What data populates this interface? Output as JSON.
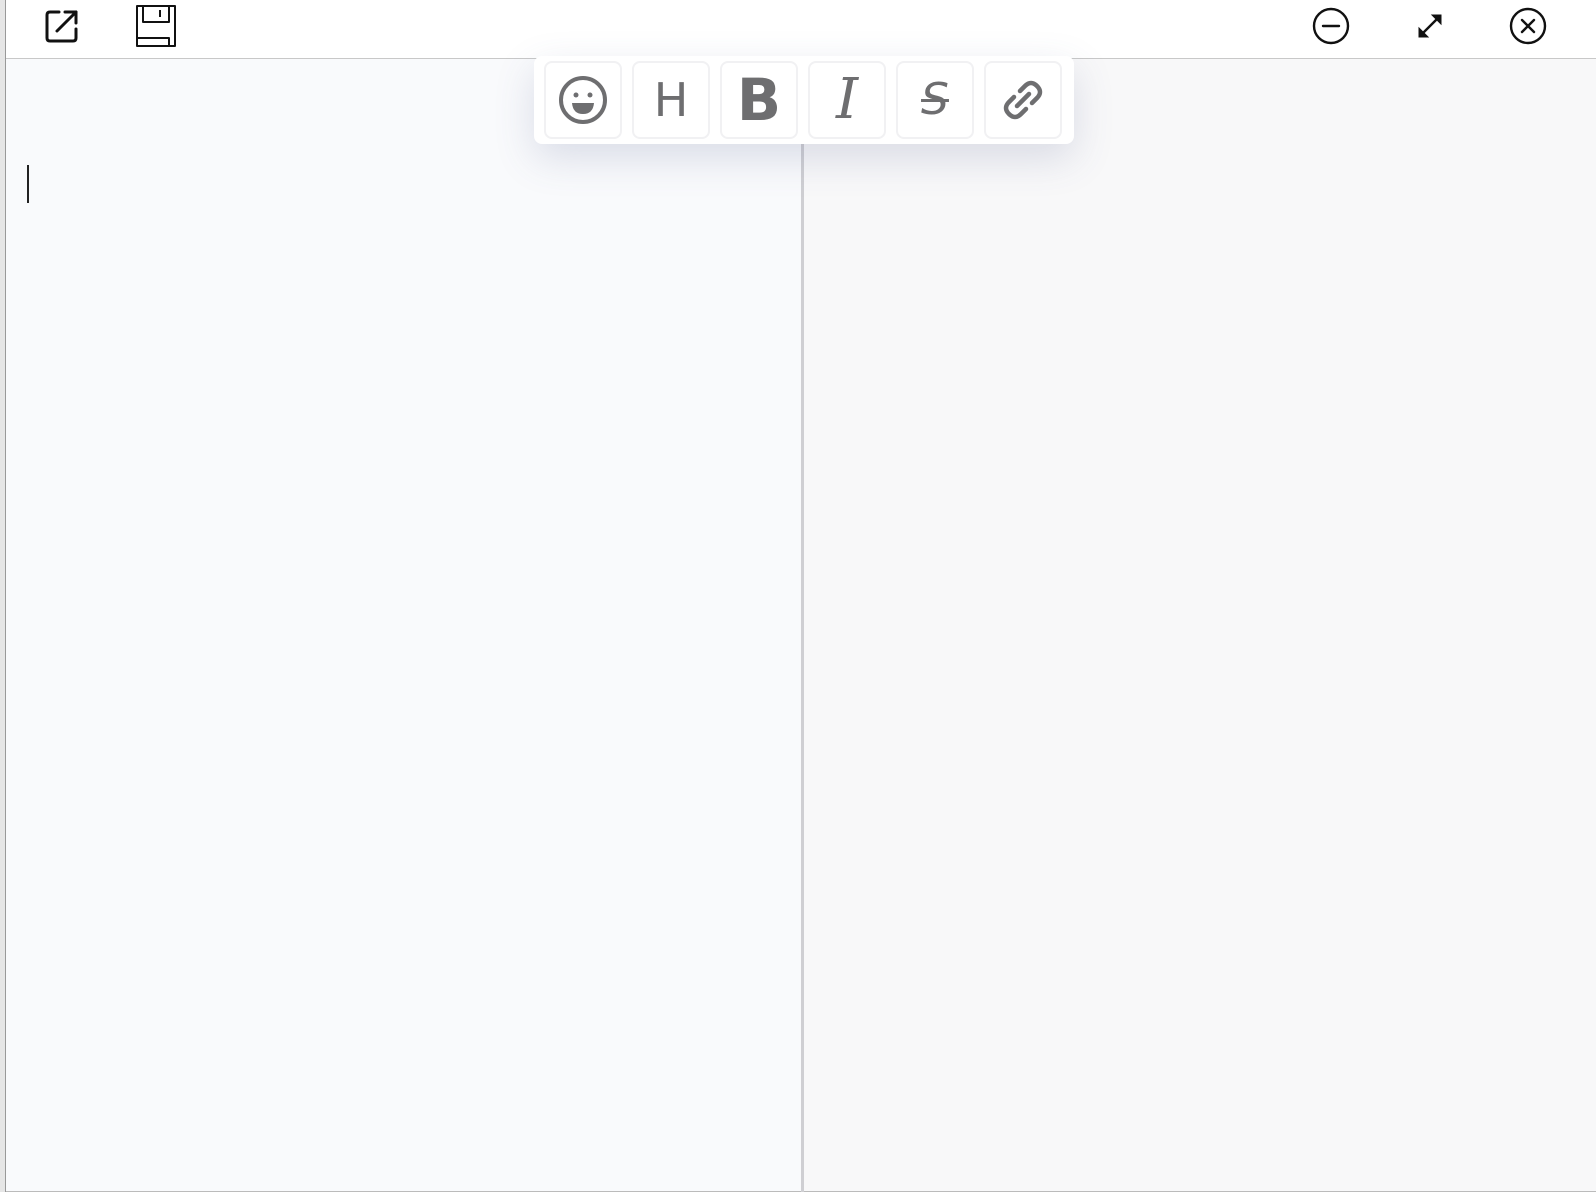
{
  "toolbar": {
    "left_icons": [
      "open-external-icon",
      "save-icon"
    ],
    "right_icons": [
      "minimize-icon",
      "expand-icon",
      "close-icon"
    ]
  },
  "format_bar": {
    "emoji": {
      "icon": "emoji-icon"
    },
    "heading": {
      "icon": "heading-icon",
      "label": "H"
    },
    "bold": {
      "icon": "bold-icon",
      "label": "B"
    },
    "italic": {
      "icon": "italic-icon",
      "label": "I"
    },
    "strikethrough": {
      "icon": "strikethrough-icon",
      "label": "S"
    },
    "link": {
      "icon": "link-icon"
    }
  },
  "editor": {
    "content": ""
  },
  "preview": {
    "content": ""
  },
  "colors": {
    "icon_gray": "#6e6e70",
    "editor_bg": "#f9fafc",
    "preview_bg": "#f8f8f9",
    "divider": "#cfcfd3"
  }
}
